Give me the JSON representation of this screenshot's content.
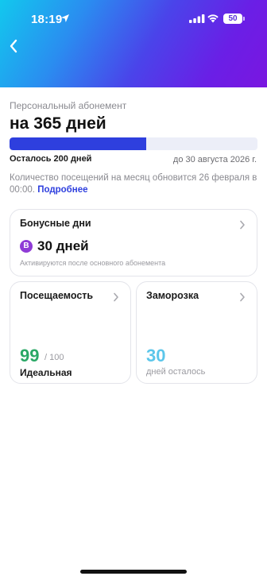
{
  "status_bar": {
    "time": "18:19",
    "battery": "50",
    "icons": [
      "location-arrow-icon",
      "cellular-signal-icon",
      "wifi-icon",
      "battery-icon"
    ]
  },
  "header": {
    "back_icon": "chevron-left-icon",
    "gradient_colors": [
      "#12c8ee",
      "#4a44ea",
      "#7a16e0"
    ]
  },
  "subscription": {
    "type": "Персональный абонемент",
    "title": "на 365 дней",
    "remaining": "Осталось 200 дней",
    "until": "до 30 августа 2026 г.",
    "progress_fraction": 0.55,
    "progress_color": "#2e3fde"
  },
  "visits_note": {
    "text": "Количество посещений на месяц обновится 26 февраля в 00:00.",
    "link": "Подробнее"
  },
  "bonus": {
    "title": "Бонусные дни",
    "badge": "B",
    "value": "30 дней",
    "note": "Активируются после основного абонемента"
  },
  "attendance": {
    "title": "Посещаемость",
    "score": "99",
    "max": "/ 100",
    "label": "Идеальная",
    "score_color": "#2aa866"
  },
  "freeze": {
    "title": "Заморозка",
    "days": "30",
    "note": "дней осталось",
    "days_color": "#5cc6ea"
  }
}
